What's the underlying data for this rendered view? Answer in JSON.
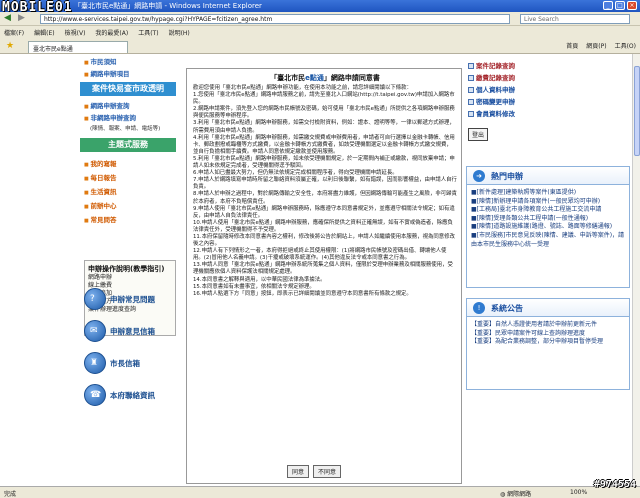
{
  "browser": {
    "title": "「臺北市民e點通」網路申請 - Windows Internet Explorer",
    "address": "http://www.e-services.taipei.gov.tw/hypage.cgi?HYPAGE=fcitizen_agree.htm",
    "search_placeholder": "Live Search",
    "menu": [
      "檔案(F)",
      "編輯(E)",
      "檢視(V)",
      "我的最愛(A)",
      "工具(T)",
      "說明(H)"
    ],
    "tab_label": "臺北市民e點通",
    "tools": [
      "首頁",
      "網頁(P)",
      "工具(O)"
    ],
    "status_left": "完成",
    "status_zone": "網際網路",
    "status_zoom": "100%",
    "watermark_left": "MOBILE01",
    "watermark_right": "#974554"
  },
  "left": {
    "top_links": [
      "市民須知",
      "網路申辦項目"
    ],
    "band1": "案件快易查市政透明",
    "mid_links": [
      "網路申辦查詢",
      "非網路申辦查詢"
    ],
    "mid_note": "(陳情、報案、申請、電話等)",
    "band2": "主題式服務",
    "theme_links": [
      "我的寫報",
      "每日報告",
      "生活資訊",
      "前辦中心",
      "常見問答"
    ],
    "guide": {
      "title": "申辦操作說明(教學指引)",
      "items": [
        "網路申辦",
        "線上繳費",
        "補正追加",
        "選擇處方",
        "案件辦理進度查詢"
      ]
    },
    "big_buttons": [
      "申辦常見問題",
      "申辦意見信箱",
      "市長信箱",
      "本府聯絡資訊"
    ]
  },
  "center": {
    "title_prefix": "「臺北市民",
    "title_em": "e點通",
    "title_suffix": "」網路申請同意書",
    "paragraphs": [
      "歡迎您使用「臺北市民e點通」網路申辦功能，在使用本功能之前，請您詳細閱讀以下條款：",
      "1.您使用「臺北市民e點通」網路申請服務之前，請先至臺北入口網站(http://t.taipei.gov.tw)申請加入網路市民。",
      "2.網路申請案件，須先登入您的網路市民帳號及密碼，始可使用「臺北市民e點通」所提供之各項網路申辦服務與便民服務等申辦程序。",
      "3.利用「臺北市民e點通」網路申辦服務，如需交付檢附資料，例如：證本、證明等等，一律以郵遞方式辦理，所需費用須由申請人負擔。",
      "4.利用「臺北市民e點通」網路申辦服務，如需繳交規費或申辦費用者，申請者可自行選擇以金融卡轉帳、信用卡、郵政劃撥或臨櫃等方式繳費，以金融卡轉帳方式繳費者，如該受理機關選定以金融卡轉帳方式繳交規費，並自行負擔相關手續費。申請人同意依規定繳款並使用服務。",
      "5.利用「臺北市民e點通」網路申辦服務，如未依受理機關規定，於一定期間內補正或繳款，視同放棄申請；申請人如未依規定完成者，受理機關得逕予駁回。",
      "6.申請人如已盡最大努力，但仍無法依規定完成相關程序者，得向受理機關申請延長。",
      "7.申請人於網路填寫申請時所留之聯絡資料須屬正確，以利日後聯繫，如有錯誤，因而影響權益，由申請人自行負責。",
      "8.申請人於申辦之過程中，對於網路傳輸之安全性，本府將盡力維護，但因網路傳輸可能產生之風險，非可歸責於本府者，本府不負賠償責任。",
      "9.申請人使用「臺北市民e點通」網路申辦服務時，除應遵守本同意書規定外，並應遵守相關法令規定；如有違反，由申請人自負法律責任。",
      "10.申請人使用「臺北市民e點通」網路申辦服務，應確保所提供之資料正確無誤，如有不實或偽造者，除應負法律責任外，受理機關得不予受理。",
      "11.本府保留隨時修改本同意書內容之權利，修改後將公告於網站上，申請人如繼續使用本服務，視為同意修改後之內容。",
      "12.申請人有下列情形之一者，本府得拒絕或終止其使用權限：(1)將網路市民帳號及密碼出借、轉讓他人使用。(2)冒用他人名義申請。(3)干擾或破壞系統運作。(4)其他違反法令或本同意書之行為。",
      "13.申請人同意「臺北市民e點通」網路申辦系統所蒐集之個人資料，僅限於受理申辦業務及相關服務使用，受理機關應依個人資料保護法相關規定處理。",
      "14.本同意書之解釋與適用，以中華民國法律為準據法。",
      "15.本同意書如有未盡事宜，依相關法令規定辦理。",
      "16.申請人點選下方「同意」按鈕，即表示已詳細閱讀並同意遵守本同意書所有條款之規定。"
    ],
    "agree": "同意",
    "disagree": "不同意"
  },
  "right": {
    "top_links": [
      "案件記錄查詢",
      "繳費記錄查詢",
      "個人資料申辦",
      "密碼變更申辦",
      "會員資料修改"
    ],
    "logout": "登出",
    "hot_title": "熱門申辦",
    "hot_items": [
      "■[新件處理]建築執照等案件(東區提供)",
      "■[陳情]新辦理申請各項案件(一般民眾均可申辦)",
      "■[工務局]臺北市身障教育公共工程施工交流申請",
      "■[陳情]受理各類公共工程申請(一般性通報)",
      "■[陳情]道路設施維護(路燈、號誌、路面等修繕通報)",
      "■[市民服務]市民意見反映(陳情、建議、申訴等案件)，請由本市民生服務中心統一受理"
    ],
    "notice_title": "系統公告",
    "notice_items": [
      "【重要】自然人憑證使用者請於申辦前更新元件",
      "【重要】民眾申請案件可線上查詢辦理進度",
      "【重要】為配合業務調整，部分申辦項目暫停受理"
    ]
  }
}
